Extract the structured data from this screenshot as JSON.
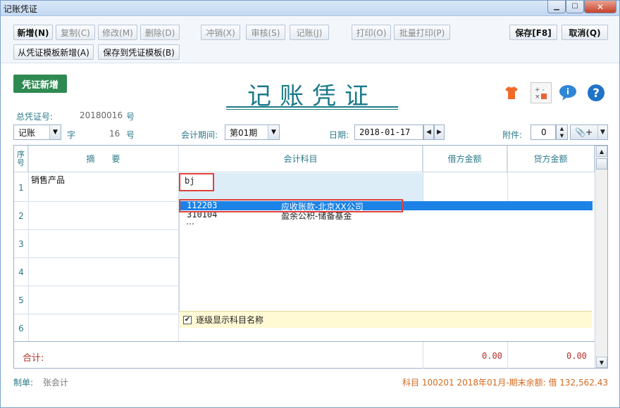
{
  "window": {
    "title": "记账凭证"
  },
  "toolbar": {
    "row1": [
      {
        "id": "new",
        "label": "新增(N)",
        "state": "bold"
      },
      {
        "id": "copy",
        "label": "复制(C)",
        "state": "disabled"
      },
      {
        "id": "modify",
        "label": "修改(M)",
        "state": "disabled"
      },
      {
        "id": "delete",
        "label": "删除(D)",
        "state": "disabled"
      },
      {
        "id": "reverse",
        "label": "冲销(X)",
        "state": "disabled"
      },
      {
        "id": "audit",
        "label": "审核(S)",
        "state": "disabled"
      },
      {
        "id": "post",
        "label": "记账(J)",
        "state": "disabled"
      },
      {
        "id": "print",
        "label": "打印(O)",
        "state": "disabled"
      },
      {
        "id": "batch_print",
        "label": "批量打印(P)",
        "state": "disabled"
      }
    ],
    "save_label": "保存[F8]",
    "cancel_label": "取消(Q)",
    "template_new_label": "从凭证模板新增(A)",
    "save_template_label": "保存到凭证模板(B)"
  },
  "header": {
    "badge": "凭证新增",
    "title": "记账凭证",
    "total_no_label": "总凭证号:",
    "total_no_value": "20180016",
    "hao": "号",
    "voucher_word": "记账",
    "zi": "字",
    "voucher_no": "16",
    "period_label": "会计期间:",
    "period_value": "第01期",
    "date_label": "日期:",
    "date_value": "2018-01-17",
    "attach_label": "附件:",
    "attach_value": "0",
    "attach_btn": "+"
  },
  "grid": {
    "headers": {
      "seq": "序号",
      "summary": "摘　　要",
      "account": "会计科目",
      "debit": "借方金额",
      "credit": "贷方金额"
    },
    "rows": [
      "1",
      "2",
      "3",
      "4",
      "5",
      "6"
    ],
    "row1_summary": "销售产品",
    "account_input": "bj",
    "dropdown": [
      {
        "code": "112203",
        "name": "应收账款-北京XX公司"
      },
      {
        "code": "310104",
        "name": "盈余公积-储备基金"
      }
    ],
    "more": "…",
    "show_level_names": "逐级显示科目名称",
    "total_label": "合计:",
    "total_debit": "0.00",
    "total_credit": "0.00"
  },
  "footer": {
    "maker_label": "制单:",
    "maker_value": "张会计",
    "status": "科目 100201  2018年01月-期末余额: 借 132,562.43"
  }
}
